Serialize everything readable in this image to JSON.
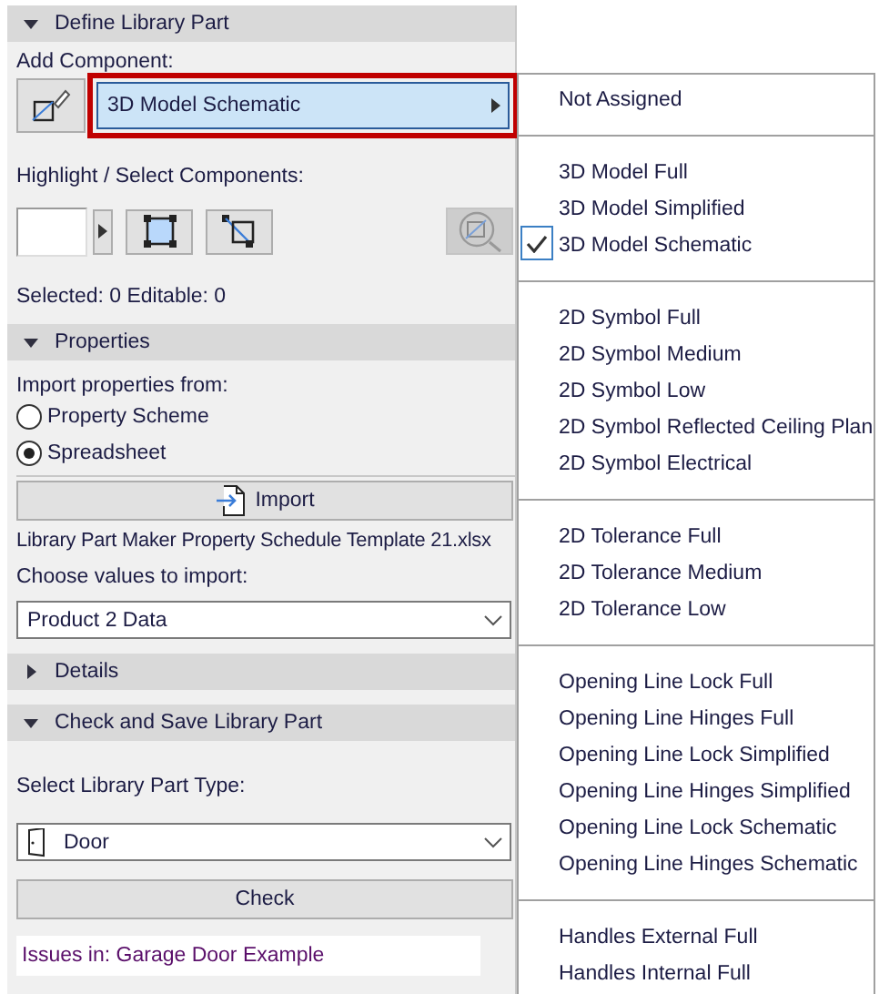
{
  "define_section": {
    "title": "Define Library Part",
    "expanded": true,
    "add_label": "Add Component:",
    "component_dropdown": {
      "value": "3D Model Schematic",
      "highlighted": true
    },
    "highlight_label": "Highlight / Select Components:",
    "zoom_button": {
      "disabled": true
    },
    "status": "Selected: 0 Editable: 0"
  },
  "properties_section": {
    "title": "Properties",
    "expanded": true,
    "import_label": "Import properties from:",
    "sources": [
      {
        "label": "Property Scheme",
        "selected": false
      },
      {
        "label": "Spreadsheet",
        "selected": true
      }
    ],
    "import_button": "Import",
    "file_name": "Library Part Maker Property Schedule Template 21.xlsx",
    "values_label": "Choose values to import:",
    "values_select": "Product 2 Data"
  },
  "details_section": {
    "title": "Details",
    "expanded": false
  },
  "check_section": {
    "title": "Check and Save Library Part",
    "expanded": true,
    "type_label": "Select Library Part Type:",
    "type_select": "Door",
    "check_button": "Check",
    "issues": "Issues in: Garage Door Example"
  },
  "component_menu": {
    "groups": [
      [
        {
          "label": "Not Assigned",
          "checked": false
        }
      ],
      [
        {
          "label": "3D Model Full",
          "checked": false
        },
        {
          "label": "3D Model Simplified",
          "checked": false
        },
        {
          "label": "3D Model Schematic",
          "checked": true
        }
      ],
      [
        {
          "label": "2D Symbol Full",
          "checked": false
        },
        {
          "label": "2D Symbol Medium",
          "checked": false
        },
        {
          "label": "2D Symbol Low",
          "checked": false
        },
        {
          "label": "2D Symbol Reflected Ceiling Plan",
          "checked": false
        },
        {
          "label": "2D Symbol Electrical",
          "checked": false
        }
      ],
      [
        {
          "label": "2D Tolerance Full",
          "checked": false
        },
        {
          "label": "2D Tolerance Medium",
          "checked": false
        },
        {
          "label": "2D Tolerance Low",
          "checked": false
        }
      ],
      [
        {
          "label": "Opening Line Lock Full",
          "checked": false
        },
        {
          "label": "Opening Line Hinges Full",
          "checked": false
        },
        {
          "label": "Opening Line Lock Simplified",
          "checked": false
        },
        {
          "label": "Opening Line Hinges Simplified",
          "checked": false
        },
        {
          "label": "Opening Line Lock Schematic",
          "checked": false
        },
        {
          "label": "Opening Line Hinges Schematic",
          "checked": false
        }
      ],
      [
        {
          "label": "Handles External Full",
          "checked": false
        },
        {
          "label": "Handles Internal Full",
          "checked": false
        }
      ]
    ]
  }
}
